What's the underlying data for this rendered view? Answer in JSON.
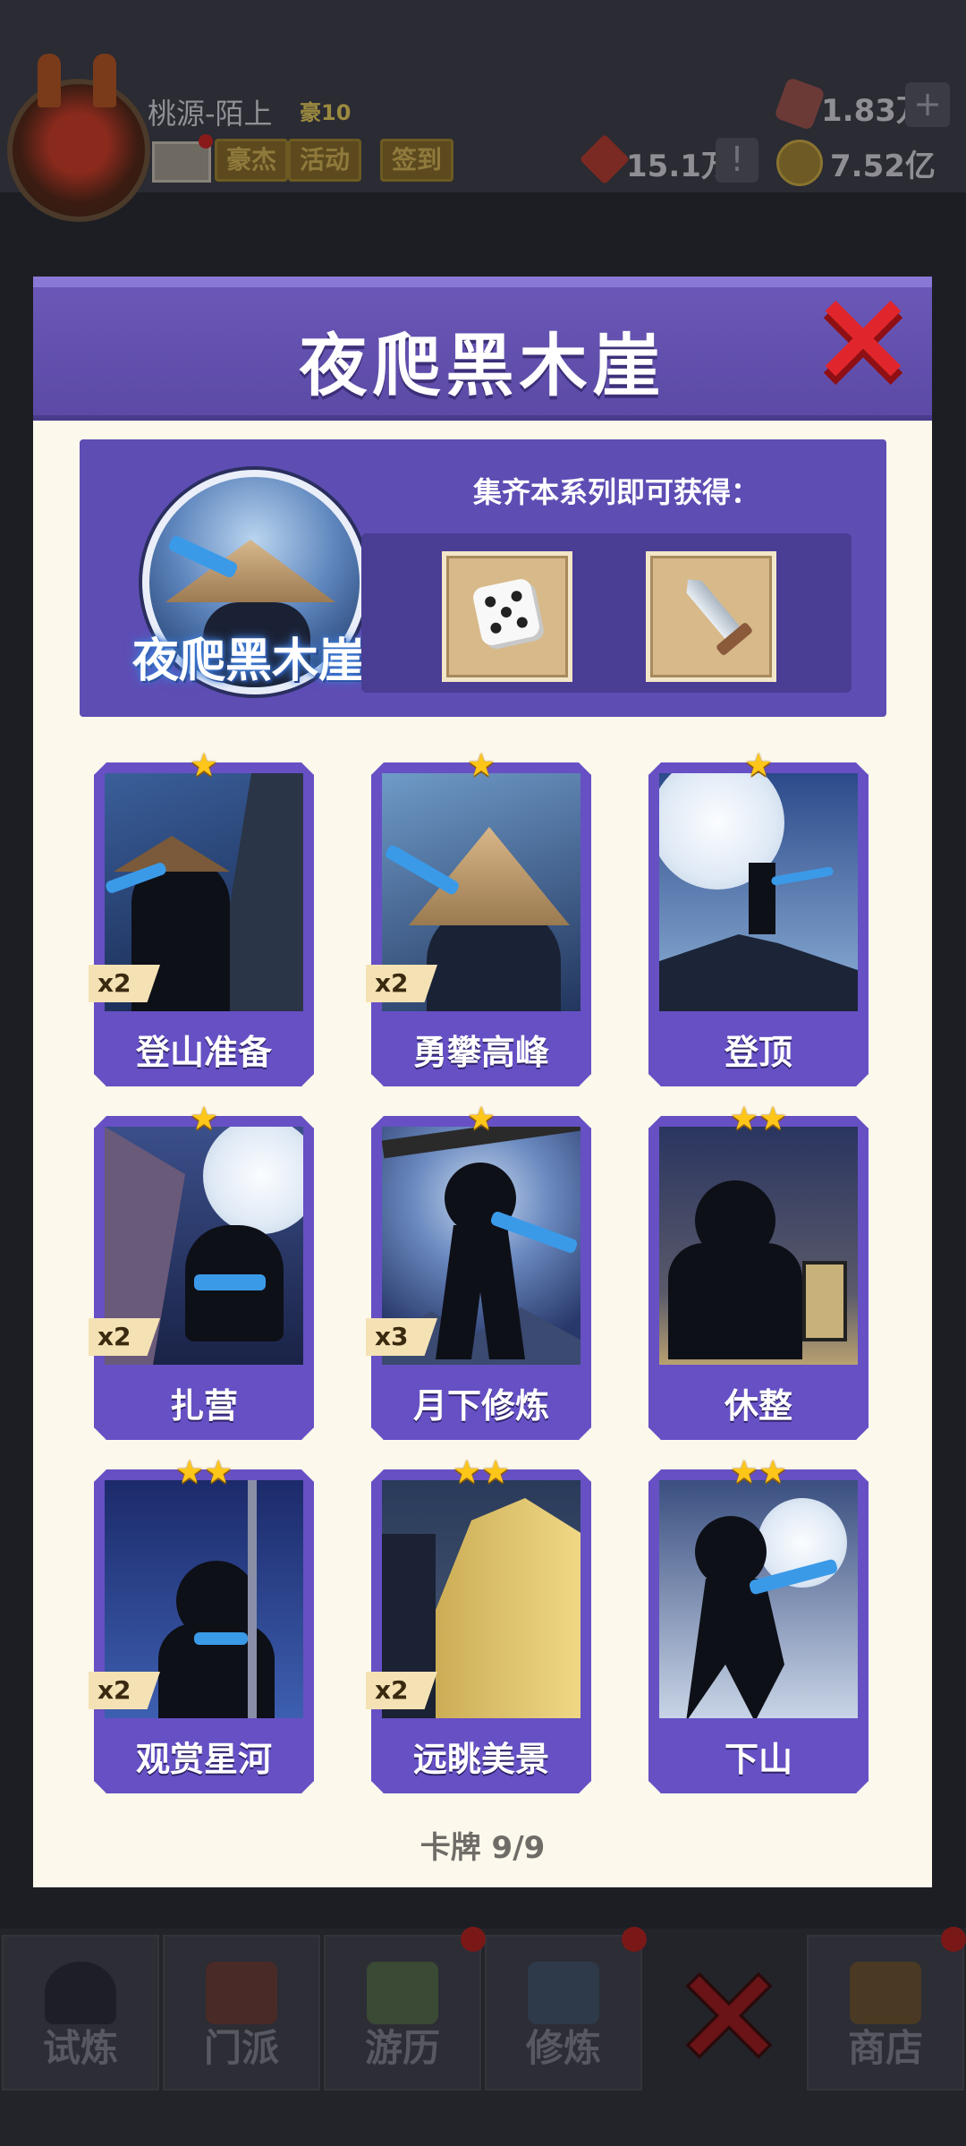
{
  "header": {
    "player_name": "桃源-陌上",
    "vip_label": "豪10",
    "buttons": [
      "豪杰",
      "活动",
      "签到"
    ],
    "resources": {
      "gem": "1.83万",
      "token": "15.1万",
      "gold": "7.52亿"
    }
  },
  "modal": {
    "title": "夜爬黑木崖",
    "banner": {
      "series_name": "夜爬黑木崖",
      "reward_title": "集齐本系列即可获得：",
      "rewards": [
        "dice-icon",
        "sword-icon"
      ]
    },
    "cards": [
      {
        "name": "登山准备",
        "stars": "★",
        "count": "x2"
      },
      {
        "name": "勇攀高峰",
        "stars": "★",
        "count": "x2"
      },
      {
        "name": "登顶",
        "stars": "★",
        "count": ""
      },
      {
        "name": "扎营",
        "stars": "★",
        "count": "x2"
      },
      {
        "name": "月下修炼",
        "stars": "★",
        "count": "x3"
      },
      {
        "name": "休整",
        "stars": "★★",
        "count": ""
      },
      {
        "name": "观赏星河",
        "stars": "★★",
        "count": "x2"
      },
      {
        "name": "远眺美景",
        "stars": "★★",
        "count": "x2"
      },
      {
        "name": "下山",
        "stars": "★★",
        "count": ""
      }
    ],
    "footer": "卡牌  9/9"
  },
  "bottom_nav": {
    "tabs": [
      "试炼",
      "门派",
      "游历",
      "修炼",
      "",
      "商店"
    ]
  },
  "colors": {
    "modal_purple": "#6650c4",
    "star_gold": "#ffc61a",
    "close_red": "#e0262c"
  }
}
